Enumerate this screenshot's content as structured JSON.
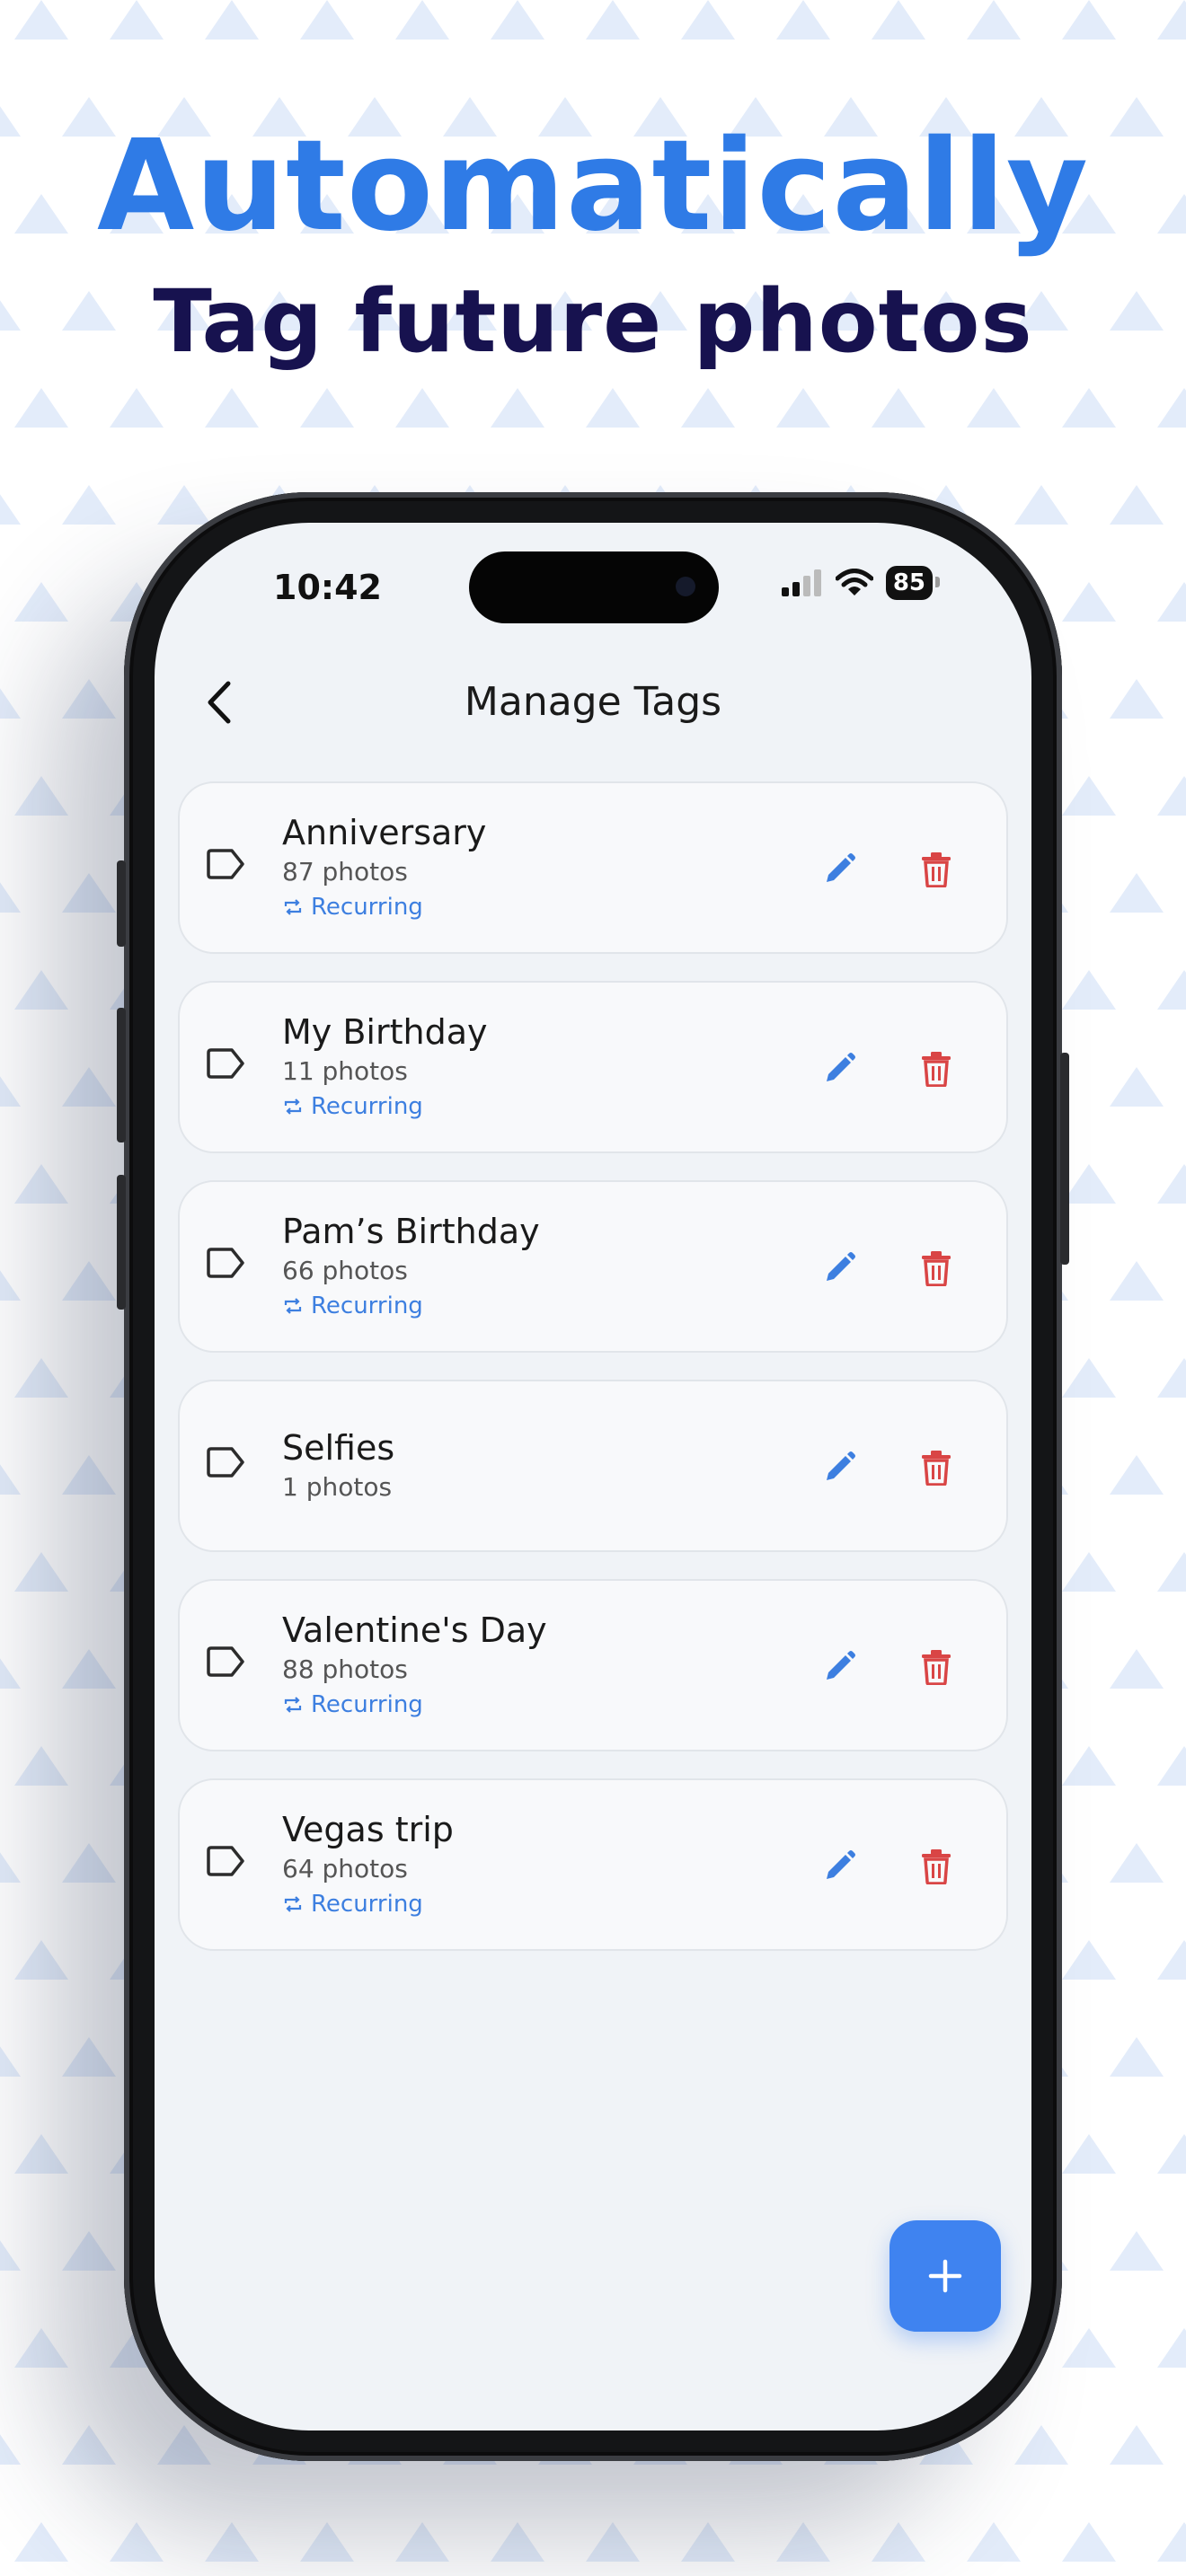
{
  "headline": {
    "line1": "Automatically",
    "line2": "Tag future photos"
  },
  "status_bar": {
    "time": "10:42",
    "battery": "85",
    "icons": [
      "signal-icon",
      "wifi-icon",
      "battery-icon"
    ]
  },
  "nav": {
    "title": "Manage Tags",
    "back_icon": "chevron-left-icon"
  },
  "tags": [
    {
      "name": "Anniversary",
      "count": "87 photos",
      "recurring": "Recurring"
    },
    {
      "name": "My Birthday",
      "count": "11 photos",
      "recurring": "Recurring"
    },
    {
      "name": "Pam’s Birthday",
      "count": "66 photos",
      "recurring": "Recurring"
    },
    {
      "name": "Selfies",
      "count": "1 photos",
      "recurring": null
    },
    {
      "name": "Valentine's Day",
      "count": "88 photos",
      "recurring": "Recurring"
    },
    {
      "name": "Vegas trip",
      "count": "64 photos",
      "recurring": "Recurring"
    }
  ],
  "fab": {
    "icon": "plus-icon"
  },
  "colors": {
    "accent": "#2f7be6",
    "headline_dark": "#17124f",
    "edit": "#3d7fe0",
    "delete": "#d94545",
    "fab": "#3f83f0"
  }
}
